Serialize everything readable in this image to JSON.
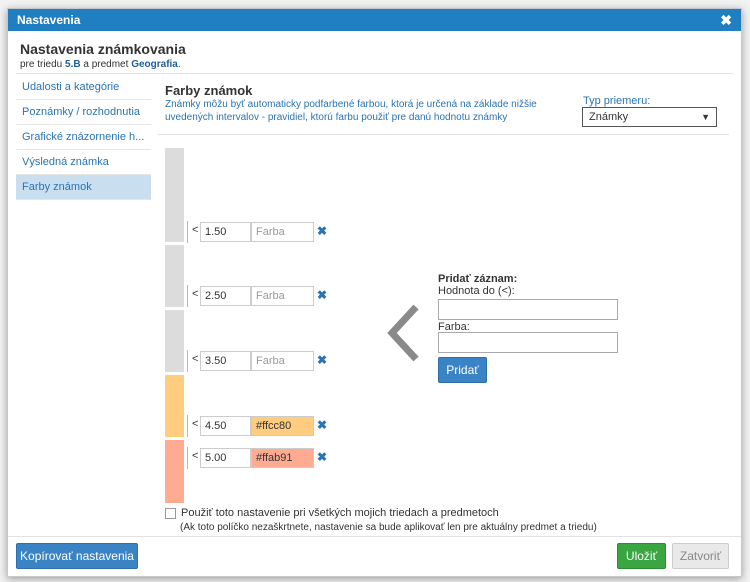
{
  "window": {
    "title": "Nastavenia",
    "close": "✖"
  },
  "header": {
    "title": "Nastavenia známkovania",
    "sub_prefix": "pre triedu",
    "class_name": "5.B",
    "sub_mid": "a predmet",
    "subject": "Geografia",
    "sub_suffix": "."
  },
  "sidebar": {
    "items": [
      {
        "label": "Udalosti a kategórie"
      },
      {
        "label": "Poznámky / rozhodnutia"
      },
      {
        "label": "Grafické znázornenie h..."
      },
      {
        "label": "Výsledná známka"
      },
      {
        "label": "Farby známok"
      }
    ]
  },
  "content": {
    "title": "Farby známok",
    "description": "Známky môžu byť automaticky podfarbené farbou, ktorá je určená na základe nižšie uvedených intervalov - pravidiel, ktorú farbu použiť pre danú hodnotu známky",
    "type_label": "Typ priemeru:",
    "type_value": "Známky",
    "type_arrow": "▼",
    "lt_sign": "<",
    "color_placeholder": "Farba",
    "delete_glyph": "✖",
    "rules": [
      {
        "value": "1.50",
        "color": "",
        "color_hex": "#dcdcdc"
      },
      {
        "value": "2.50",
        "color": "",
        "color_hex": "#dcdcdc"
      },
      {
        "value": "3.50",
        "color": "",
        "color_hex": "#dcdcdc"
      },
      {
        "value": "4.50",
        "color": "#ffcc80",
        "color_hex": "#ffcc80"
      },
      {
        "value": "5.00",
        "color": "#ffab91",
        "color_hex": "#ffab91"
      }
    ],
    "tail_color_hex": "#ffab91"
  },
  "add_panel": {
    "title": "Pridať záznam:",
    "value_label": "Hodnota do (<):",
    "value_input": "",
    "color_label": "Farba:",
    "color_input": "",
    "add_button": "Pridať"
  },
  "options": {
    "apply_all_label": "Použiť toto nastavenie pri všetkých mojich triedach a predmetoch",
    "apply_all_note": "(Ak toto políčko nezaškrtnete, nastavenie sa bude aplikovať len pre aktuálny predmet a triedu)"
  },
  "footer": {
    "copy_button": "Kopírovať nastavenia",
    "save_button": "Uložiť",
    "close_button": "Zatvoriť"
  },
  "colors": {
    "accent": "#1f7fc1",
    "link": "#2a74b3",
    "save": "#3aa641"
  }
}
